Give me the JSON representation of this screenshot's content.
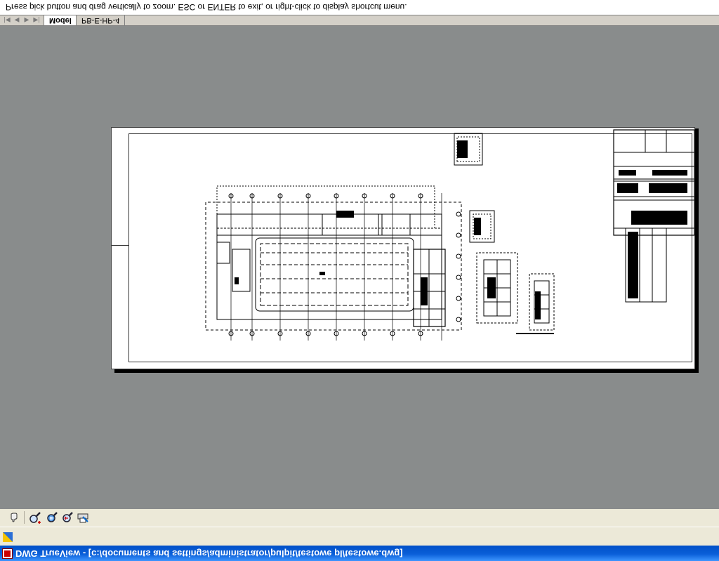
{
  "window": {
    "title": "DWG TrueView - [c:/documents and settings/administrator/pulpit/testowe pl/testowe.dwg]",
    "title_bar_color": "#0a5fd8"
  },
  "toolbar": {
    "buttons": [
      {
        "name": "pan-realtime-icon"
      },
      {
        "name": "zoom-realtime-icon"
      },
      {
        "name": "zoom-window-icon"
      },
      {
        "name": "zoom-previous-icon"
      },
      {
        "name": "plot-icon"
      }
    ]
  },
  "layout_tabs": {
    "nav": [
      "|◀",
      "◀",
      "▶",
      "▶|"
    ],
    "tabs": [
      {
        "label": "Model",
        "active": true
      },
      {
        "label": "PB-E-HP-4",
        "active": false
      }
    ]
  },
  "command_line": {
    "prompt": "Press pick button and drag vertically to zoom. ESC or ENTER to exit, or right-click to display shortcut menu."
  },
  "canvas": {
    "background_color": "#898c8c",
    "paper_color": "#ffffff"
  }
}
